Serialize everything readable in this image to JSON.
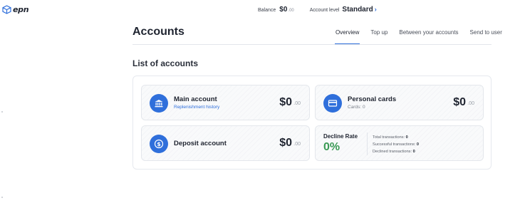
{
  "brand": {
    "name": "epn",
    "logo_icon": "cube-logo-icon"
  },
  "topbar": {
    "balance_label": "Balance",
    "balance_amount": "$0",
    "balance_cents": ".00",
    "level_label": "Account level",
    "level_value": "Standard",
    "level_chevron": "›"
  },
  "header": {
    "title": "Accounts",
    "tabs": [
      {
        "label": "Overview",
        "active": true
      },
      {
        "label": "Top up",
        "active": false
      },
      {
        "label": "Between your accounts",
        "active": false
      },
      {
        "label": "Send to user",
        "active": false
      }
    ]
  },
  "section": {
    "title": "List of accounts"
  },
  "cards": {
    "main": {
      "title": "Main account",
      "link": "Replenishment history",
      "amount": "$0",
      "cents": ".00",
      "icon": "bank-icon"
    },
    "personal": {
      "title": "Personal cards",
      "sub": "Cards: 0",
      "amount": "$0",
      "cents": ".00",
      "icon": "credit-card-icon"
    },
    "deposit": {
      "title": "Deposit account",
      "amount": "$0",
      "cents": ".00",
      "icon": "dollar-coin-icon"
    },
    "decline": {
      "label": "Decline Rate",
      "value": "0%",
      "total_label": "Total transactions:",
      "total_value": "0",
      "success_label": "Successful transactions:",
      "success_value": "0",
      "declined_label": "Declined transactions:",
      "declined_value": "0"
    }
  },
  "colors": {
    "accent": "#2f6fdb",
    "success": "#3a9a55",
    "text": "#1f2430"
  }
}
